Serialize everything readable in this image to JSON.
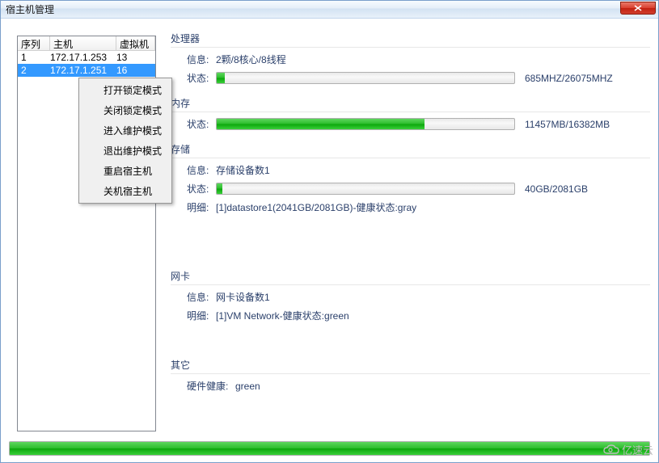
{
  "window": {
    "title": "宿主机管理"
  },
  "table": {
    "headers": {
      "seq": "序列",
      "host": "主机",
      "vm": "虚拟机"
    },
    "rows": [
      {
        "seq": "1",
        "host": "172.17.1.253",
        "vm": "13"
      },
      {
        "seq": "2",
        "host": "172.17.1.251",
        "vm": "16"
      }
    ]
  },
  "context_menu": {
    "items": [
      "打开锁定模式",
      "关闭锁定模式",
      "进入维护模式",
      "退出维护模式",
      "重启宿主机",
      "关机宿主机"
    ]
  },
  "sections": {
    "cpu": {
      "title": "处理器",
      "info_label": "信息:",
      "info_value": "2颗/8核心/8线程",
      "status_label": "状态:",
      "status_text": "685MHZ/26075MHZ",
      "status_pct": 2.6
    },
    "mem": {
      "title": "内存",
      "status_label": "状态:",
      "status_text": "11457MB/16382MB",
      "status_pct": 69.9
    },
    "storage": {
      "title": "存储",
      "info_label": "信息:",
      "info_value": "存储设备数1",
      "status_label": "状态:",
      "status_text": "40GB/2081GB",
      "status_pct": 1.9,
      "detail_label": "明细:",
      "detail_value": "[1]datastore1(2041GB/2081GB)-健康状态:gray"
    },
    "nic": {
      "title": "网卡",
      "info_label": "信息:",
      "info_value": "网卡设备数1",
      "detail_label": "明细:",
      "detail_value": "[1]VM Network-健康状态:green"
    },
    "other": {
      "title": "其它",
      "hw_label": "硬件健康:",
      "hw_value": "green"
    }
  },
  "watermark": "亿速云"
}
